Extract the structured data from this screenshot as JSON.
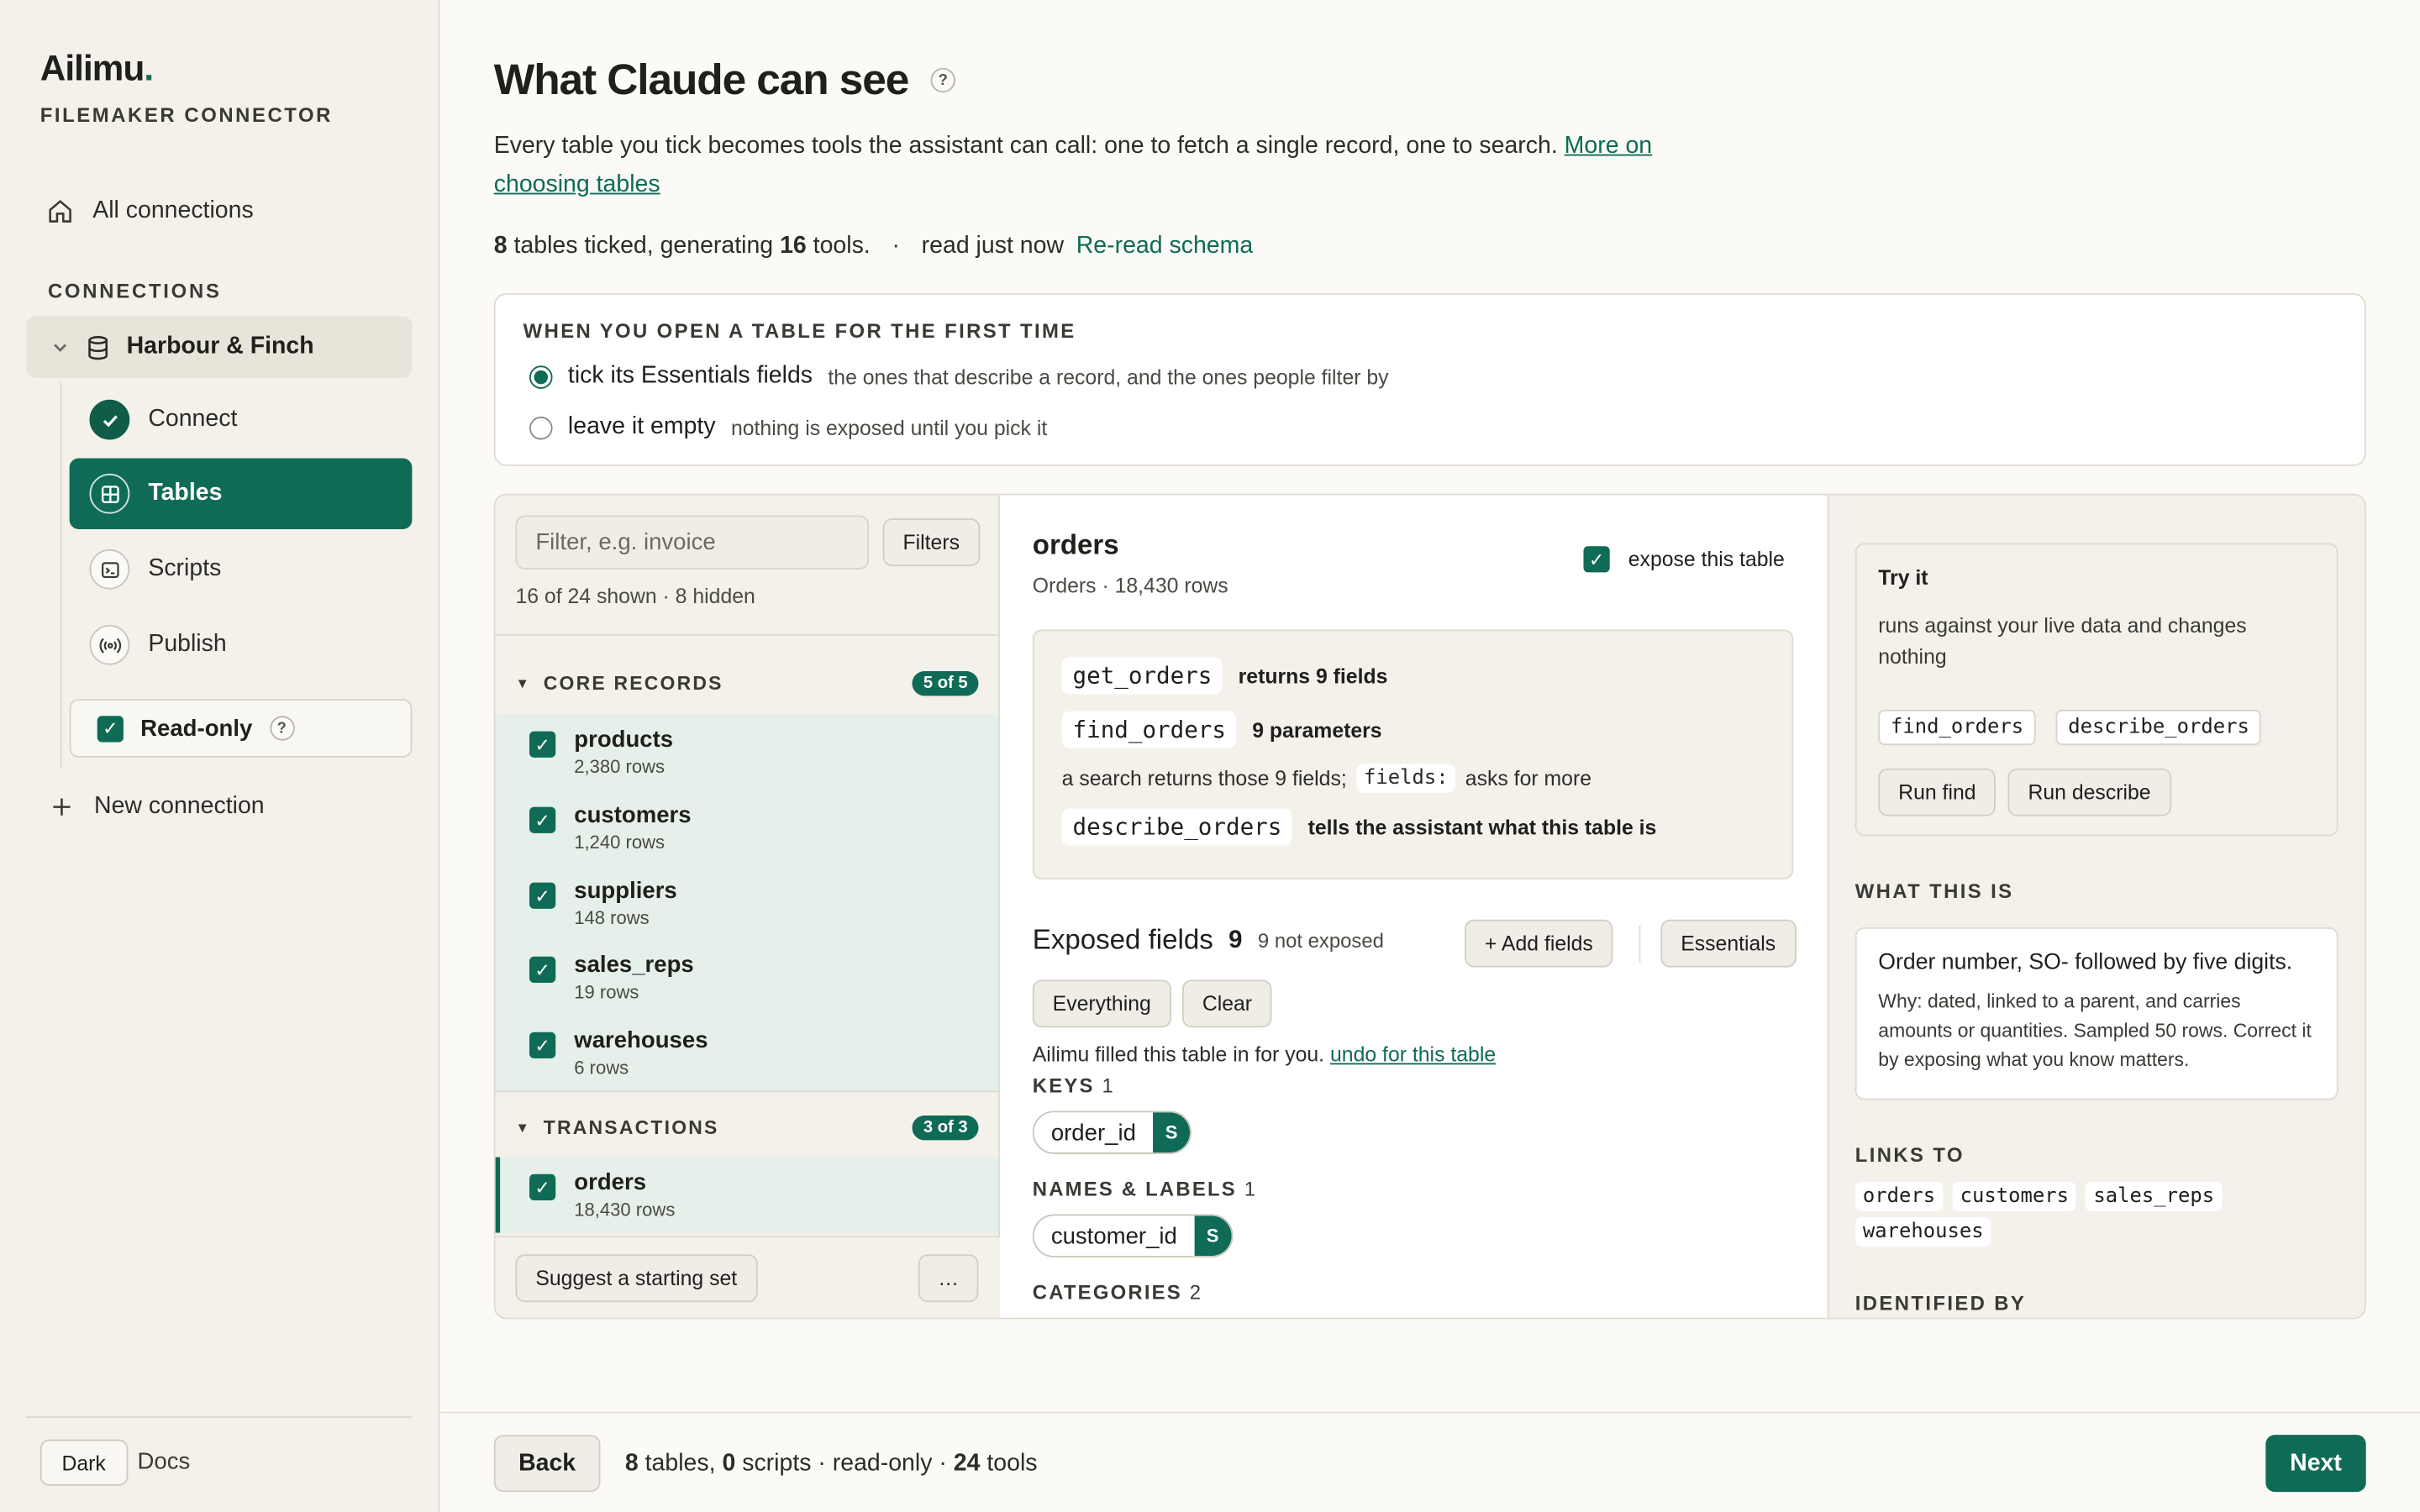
{
  "brand": {
    "name": "Ailimu",
    "dot": ".",
    "subtitle": "FILEMAKER CONNECTOR"
  },
  "sidebar": {
    "all_connections": "All connections",
    "section_label": "CONNECTIONS",
    "connection_name": "Harbour & Finch",
    "steps": [
      {
        "label": "Connect",
        "state": "done"
      },
      {
        "label": "Tables",
        "state": "active"
      },
      {
        "label": "Scripts",
        "state": "todo"
      },
      {
        "label": "Publish",
        "state": "todo"
      }
    ],
    "readonly_label": "Read-only",
    "help_glyph": "?",
    "new_connection": "New connection",
    "dark_button": "Dark",
    "docs": "Docs"
  },
  "header": {
    "title": "What Claude can see",
    "help_glyph": "?",
    "description": "Every table you tick becomes tools the assistant can call: one to fetch a single record, one to search.",
    "more_link": "More on choosing tables",
    "tables_count": "8",
    "tables_text": "tables ticked, generating",
    "tools_count": "16",
    "tools_text": "tools.",
    "sep": "·",
    "read_status": "read just now",
    "reread_link": "Re-read schema"
  },
  "first_time": {
    "label": "WHEN YOU OPEN A TABLE FOR THE FIRST TIME",
    "options": [
      {
        "label": "tick its Essentials fields",
        "hint": "the ones that describe a record, and the ones people filter by",
        "selected": true
      },
      {
        "label": "leave it empty",
        "hint": "nothing is exposed until you pick it",
        "selected": false
      }
    ]
  },
  "table_list": {
    "filter_placeholder": "Filter, e.g. invoice",
    "filters_button": "Filters",
    "shown_text": "16 of 24 shown · 8 hidden",
    "groups": [
      {
        "name": "CORE RECORDS",
        "badge": "5 of 5",
        "tables": [
          {
            "name": "products",
            "rows": "2,380 rows"
          },
          {
            "name": "customers",
            "rows": "1,240 rows"
          },
          {
            "name": "suppliers",
            "rows": "148 rows"
          },
          {
            "name": "sales_reps",
            "rows": "19 rows"
          },
          {
            "name": "warehouses",
            "rows": "6 rows"
          }
        ]
      },
      {
        "name": "TRANSACTIONS",
        "badge": "3 of 3",
        "tables": [
          {
            "name": "orders",
            "rows": "18,430 rows"
          }
        ]
      }
    ],
    "suggest_button": "Suggest a starting set",
    "more_button": "…"
  },
  "detail": {
    "name": "orders",
    "subtitle": "Orders · 18,430 rows",
    "expose_label": "expose this table",
    "tools": {
      "get": "get_orders",
      "get_desc": "returns 9 fields",
      "find": "find_orders",
      "find_desc": "9 parameters",
      "search_note_a": "a search returns those 9 fields;",
      "search_note_code": "fields:",
      "search_note_b": "asks for more",
      "describe": "describe_orders",
      "describe_desc": "tells the assistant what this table is"
    },
    "exposed_heading": "Exposed fields",
    "exposed_count": "9",
    "not_exposed": "9 not exposed",
    "add_fields": "+ Add fields",
    "essentials": "Essentials",
    "everything": "Everything",
    "clear": "Clear",
    "filled_note": "Ailimu filled this table in for you.",
    "undo_link": "undo for this table",
    "keys_label": "KEYS",
    "keys_count": "1",
    "key_field": "order_id",
    "names_label": "NAMES & LABELS",
    "names_count": "1",
    "name_field": "customer_id",
    "field_badge": "S",
    "categories_label": "CATEGORIES",
    "categories_count": "2"
  },
  "inspector": {
    "try_title": "Try it",
    "try_desc": "runs against your live data and changes nothing",
    "try_tool_find": "find_orders",
    "try_tool_describe": "describe_orders",
    "run_find": "Run find",
    "run_describe": "Run describe",
    "what_label": "WHAT THIS IS",
    "what_title": "Order number, SO- followed by five digits.",
    "what_desc": "Why: dated, linked to a parent, and carries amounts or quantities. Sampled 50 rows. Correct it by exposing what you know matters.",
    "links_label": "LINKS TO",
    "links": [
      "orders",
      "customers",
      "sales_reps",
      "warehouses"
    ],
    "identified_label": "IDENTIFIED BY"
  },
  "footer": {
    "back": "Back",
    "tables_n": "8",
    "tables_t": "tables,",
    "scripts_n": "0",
    "scripts_t": "scripts · read-only ·",
    "tools_n": "24",
    "tools_t": "tools",
    "next": "Next"
  },
  "colors": {
    "accent": "#0f6b55",
    "selected_row": "#e5f0ea",
    "sidebar_bg": "#f3f1ea"
  }
}
